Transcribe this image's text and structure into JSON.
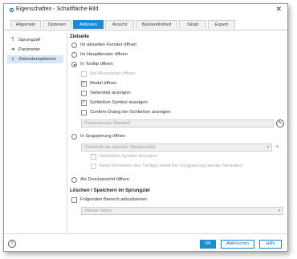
{
  "window": {
    "title": "Eigenschaften - Schaltfläche Bild"
  },
  "tabs": [
    {
      "label": "Allgemein"
    },
    {
      "label": "Optionen"
    },
    {
      "label": "Aktionen"
    },
    {
      "label": "Ansicht"
    },
    {
      "label": "Barrierefreiheit"
    },
    {
      "label": "Skript"
    },
    {
      "label": "Expert"
    }
  ],
  "sidebar": {
    "items": [
      {
        "label": "Sprungziel",
        "icon": "T"
      },
      {
        "label": "Parameter",
        "icon": "➜"
      },
      {
        "label": "Zielseitenoptionen",
        "icon": "⭳"
      }
    ]
  },
  "zielseite": {
    "header": "Zielseite",
    "opt_current": "Im aktuellen Fenster öffnen",
    "opt_main": "Im Hauptfenster öffnen",
    "opt_tooltip": "In Tooltip öffnen",
    "cb_mouseover": "Bei Mouseover öffnen",
    "cb_modal": "Modal öffnen",
    "cb_pagetitle": "Seitentitel anzeigen",
    "cb_close_symbol": "Schließen Symbol anzeigen",
    "cb_confirm": "Confirm-Dialog bei Schließen anzeigen",
    "position_field": "Positionierung: Standard",
    "opt_group": "In Gruppierung öffnen",
    "group_dropdown": "(Unterhalb der aktuellen Tabellenzeile)",
    "cb_group_close_symbol": "Schließen Symbol anzeigen",
    "cb_group_restore": "Beim Schließen des Tooltips Inhalt der Gruppierung wieder herstellen",
    "opt_print": "Als Druckansicht öffnen"
  },
  "delete_section": {
    "header": "Löschen / Speichern im Sprungziel",
    "cb_refresh": "Folgenden Bereich aktualisieren",
    "area_dropdown": "<Ganze Seite>"
  },
  "footer": {
    "help_icon": "?",
    "ok_label": "OK",
    "cancel_label": "Abbrechen",
    "help_label": "Hilfe"
  },
  "colors": {
    "accent": "#1a8bd6"
  }
}
